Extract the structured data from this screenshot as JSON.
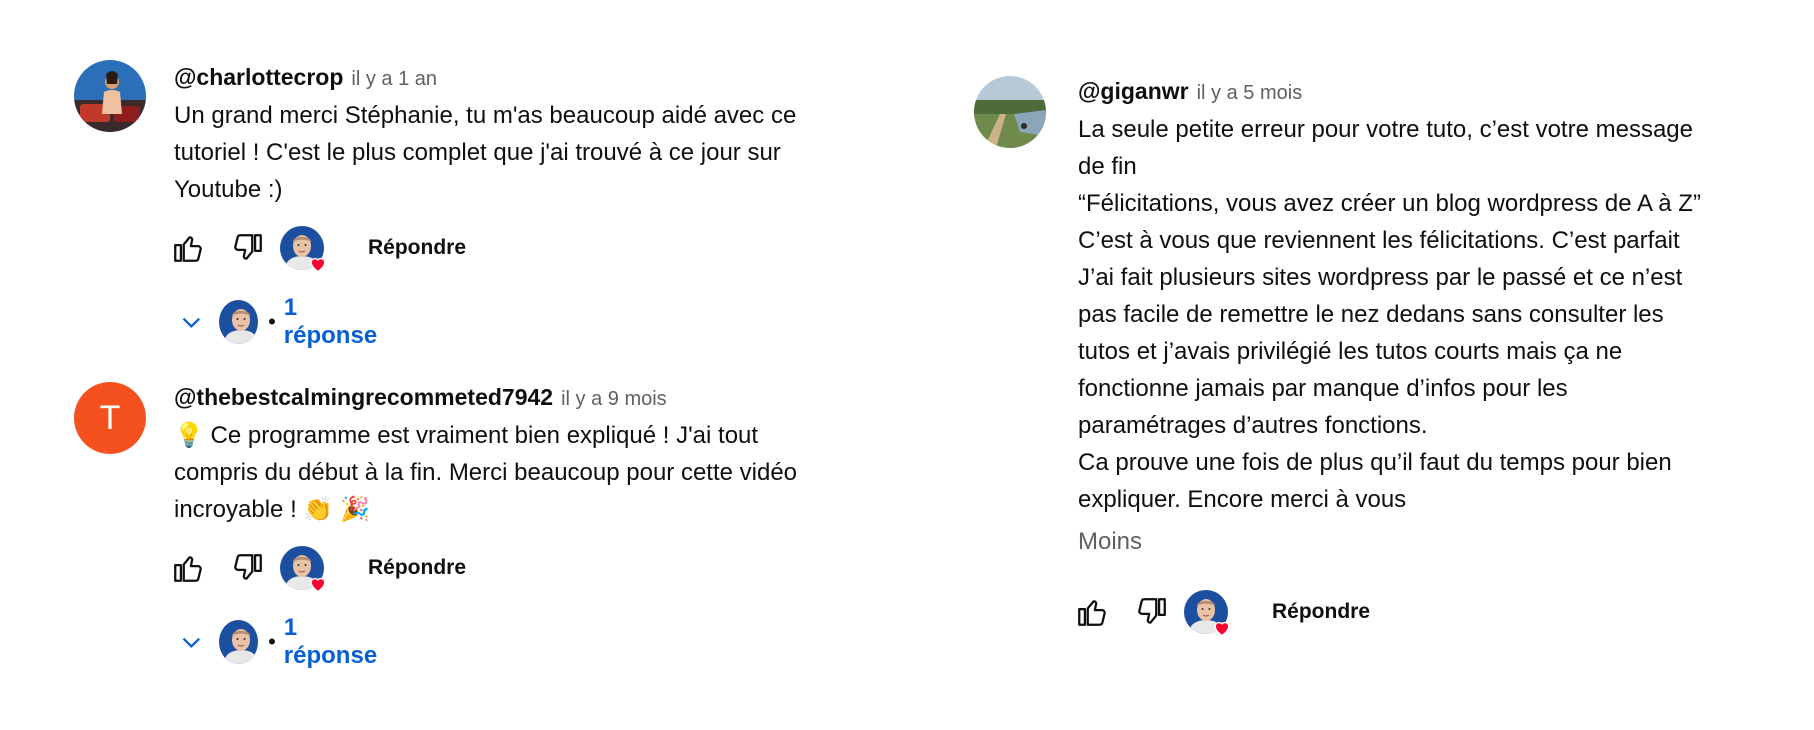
{
  "colors": {
    "link": "#065fd4",
    "muted": "#606060",
    "letter_avatar": "#f4511e",
    "heart": "#ff0033"
  },
  "comments": [
    {
      "author": "@charlottecrop",
      "time": "il y a 1 an",
      "lines": [
        "Un grand merci Stéphanie, tu m'as beaucoup aidé avec ce",
        "tutoriel ! C'est le plus complet que j'ai trouvé à ce jour sur",
        "Youtube :)"
      ],
      "reply_label": "Répondre",
      "replies_label": "1 réponse"
    },
    {
      "author": "@thebestcalmingrecommeted7942",
      "time": "il y a 9 mois",
      "avatar_letter": "T",
      "lines": [
        "💡  Ce programme est vraiment bien expliqué ! J'ai tout",
        "compris du début à la fin. Merci beaucoup pour cette vidéo",
        "incroyable ! 👏 🎉"
      ],
      "reply_label": "Répondre",
      "replies_label": "1 réponse"
    },
    {
      "author": "@giganwr",
      "time": "il y a 5 mois",
      "lines": [
        "La seule petite erreur pour votre tuto, c’est votre message",
        "de fin",
        "“Félicitations, vous avez créer un blog wordpress de A à Z”",
        "C’est à  vous que reviennent les félicitations. C’est parfait",
        "J’ai fait plusieurs sites wordpress par le passé et ce n’est",
        "pas facile de remettre le nez dedans sans consulter les",
        "tutos et j’avais privilégié les tutos courts mais ça ne",
        "fonctionne jamais par manque d’infos pour les",
        "paramétrages d’autres fonctions.",
        "Ca prouve une fois de plus qu’il faut du temps pour bien",
        "expliquer. Encore merci à vous"
      ],
      "less_label": "Moins",
      "reply_label": "Répondre"
    }
  ]
}
